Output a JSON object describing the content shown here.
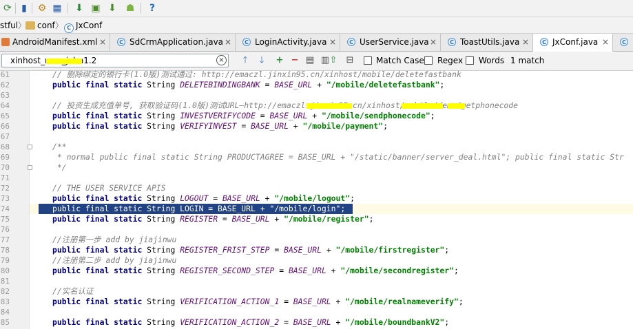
{
  "breadcrumb": {
    "items": [
      "stful",
      "conf",
      "JxConf"
    ]
  },
  "tabs": [
    {
      "label": "AndroidManifest.xml",
      "icon": "xml-file-icon"
    },
    {
      "label": "SdCrmApplication.java",
      "icon": "java-class-icon"
    },
    {
      "label": "LoginActivity.java",
      "icon": "java-class-icon"
    },
    {
      "label": "UserService.java",
      "icon": "java-class-icon"
    },
    {
      "label": "ToastUtils.java",
      "icon": "java-class-icon"
    },
    {
      "label": "JxConf.java",
      "icon": "java-class-icon",
      "active": true
    }
  ],
  "search": {
    "value": "xinhost_new_jxlm1.2",
    "match_case_label": "Match Case",
    "regex_label": "Regex",
    "words_label": "Words",
    "match_count": "1 match"
  },
  "editor": {
    "lines": [
      {
        "n": "61",
        "text": "// 删除绑定的银行卡(1.0版)测试通过: http://emaczl.jinxin95.cn/xinhost/mobile/deletefastbank"
      },
      {
        "n": "62",
        "text": "public final static String DELETEBINDINGBANK = BASE_URL + \"/mobile/deletefastbank\";"
      },
      {
        "n": "63",
        "text": ""
      },
      {
        "n": "64",
        "text": "// 投资生成充值单号, 获取验证码(1.0版)测试URL—http://emaczl.jinxin95.cn/xinhost/mobile/demo/getphonecode"
      },
      {
        "n": "65",
        "text": "public final static String INVESTVERIFYCODE = BASE_URL + \"/mobile/sendphonecode\";"
      },
      {
        "n": "66",
        "text": "public final static String VERIFYINVEST = BASE_URL + \"/mobile/payment\";"
      },
      {
        "n": "67",
        "text": ""
      },
      {
        "n": "68",
        "text": "/**"
      },
      {
        "n": "69",
        "text": " * normal public final static String PRODUCTAGREE = BASE_URL + \"/static/banner/server_deal.html\"; public final static Str"
      },
      {
        "n": "70",
        "text": " */"
      },
      {
        "n": "71",
        "text": ""
      },
      {
        "n": "72",
        "text": "// THE USER SERVICE APIS"
      },
      {
        "n": "73",
        "text": "public final static String LOGOUT = BASE_URL + \"/mobile/logout\";"
      },
      {
        "n": "74",
        "text": "public final static String LOGIN = BASE_URL + \"/mobile/login\";"
      },
      {
        "n": "75",
        "text": "public final static String REGISTER = BASE_URL + \"/mobile/register\";"
      },
      {
        "n": "76",
        "text": ""
      },
      {
        "n": "77",
        "text": "//注册第一步 add by jiajinwu"
      },
      {
        "n": "78",
        "text": "public final static String REGISTER_FRIST_STEP = BASE_URL + \"/mobile/firstregister\";"
      },
      {
        "n": "79",
        "text": "//注册第二步 add by jiajinwu"
      },
      {
        "n": "80",
        "text": "public final static String REGISTER_SECOND_STEP = BASE_URL + \"/mobile/secondregister\";"
      },
      {
        "n": "81",
        "text": ""
      },
      {
        "n": "82",
        "text": "//实名认证"
      },
      {
        "n": "83",
        "text": "public final static String VERIFICATION_ACTION_1 = BASE_URL + \"/mobile/realnameverify\";"
      },
      {
        "n": "84",
        "text": ""
      },
      {
        "n": "85",
        "text": "public final static String VERIFICATION_ACTION_2 = BASE_URL + \"/mobile/boundbankV2\";"
      }
    ]
  },
  "colors": {
    "selection": "#214283",
    "keyword": "#000080",
    "string": "#008000",
    "field": "#660e7a",
    "comment": "#808080"
  }
}
